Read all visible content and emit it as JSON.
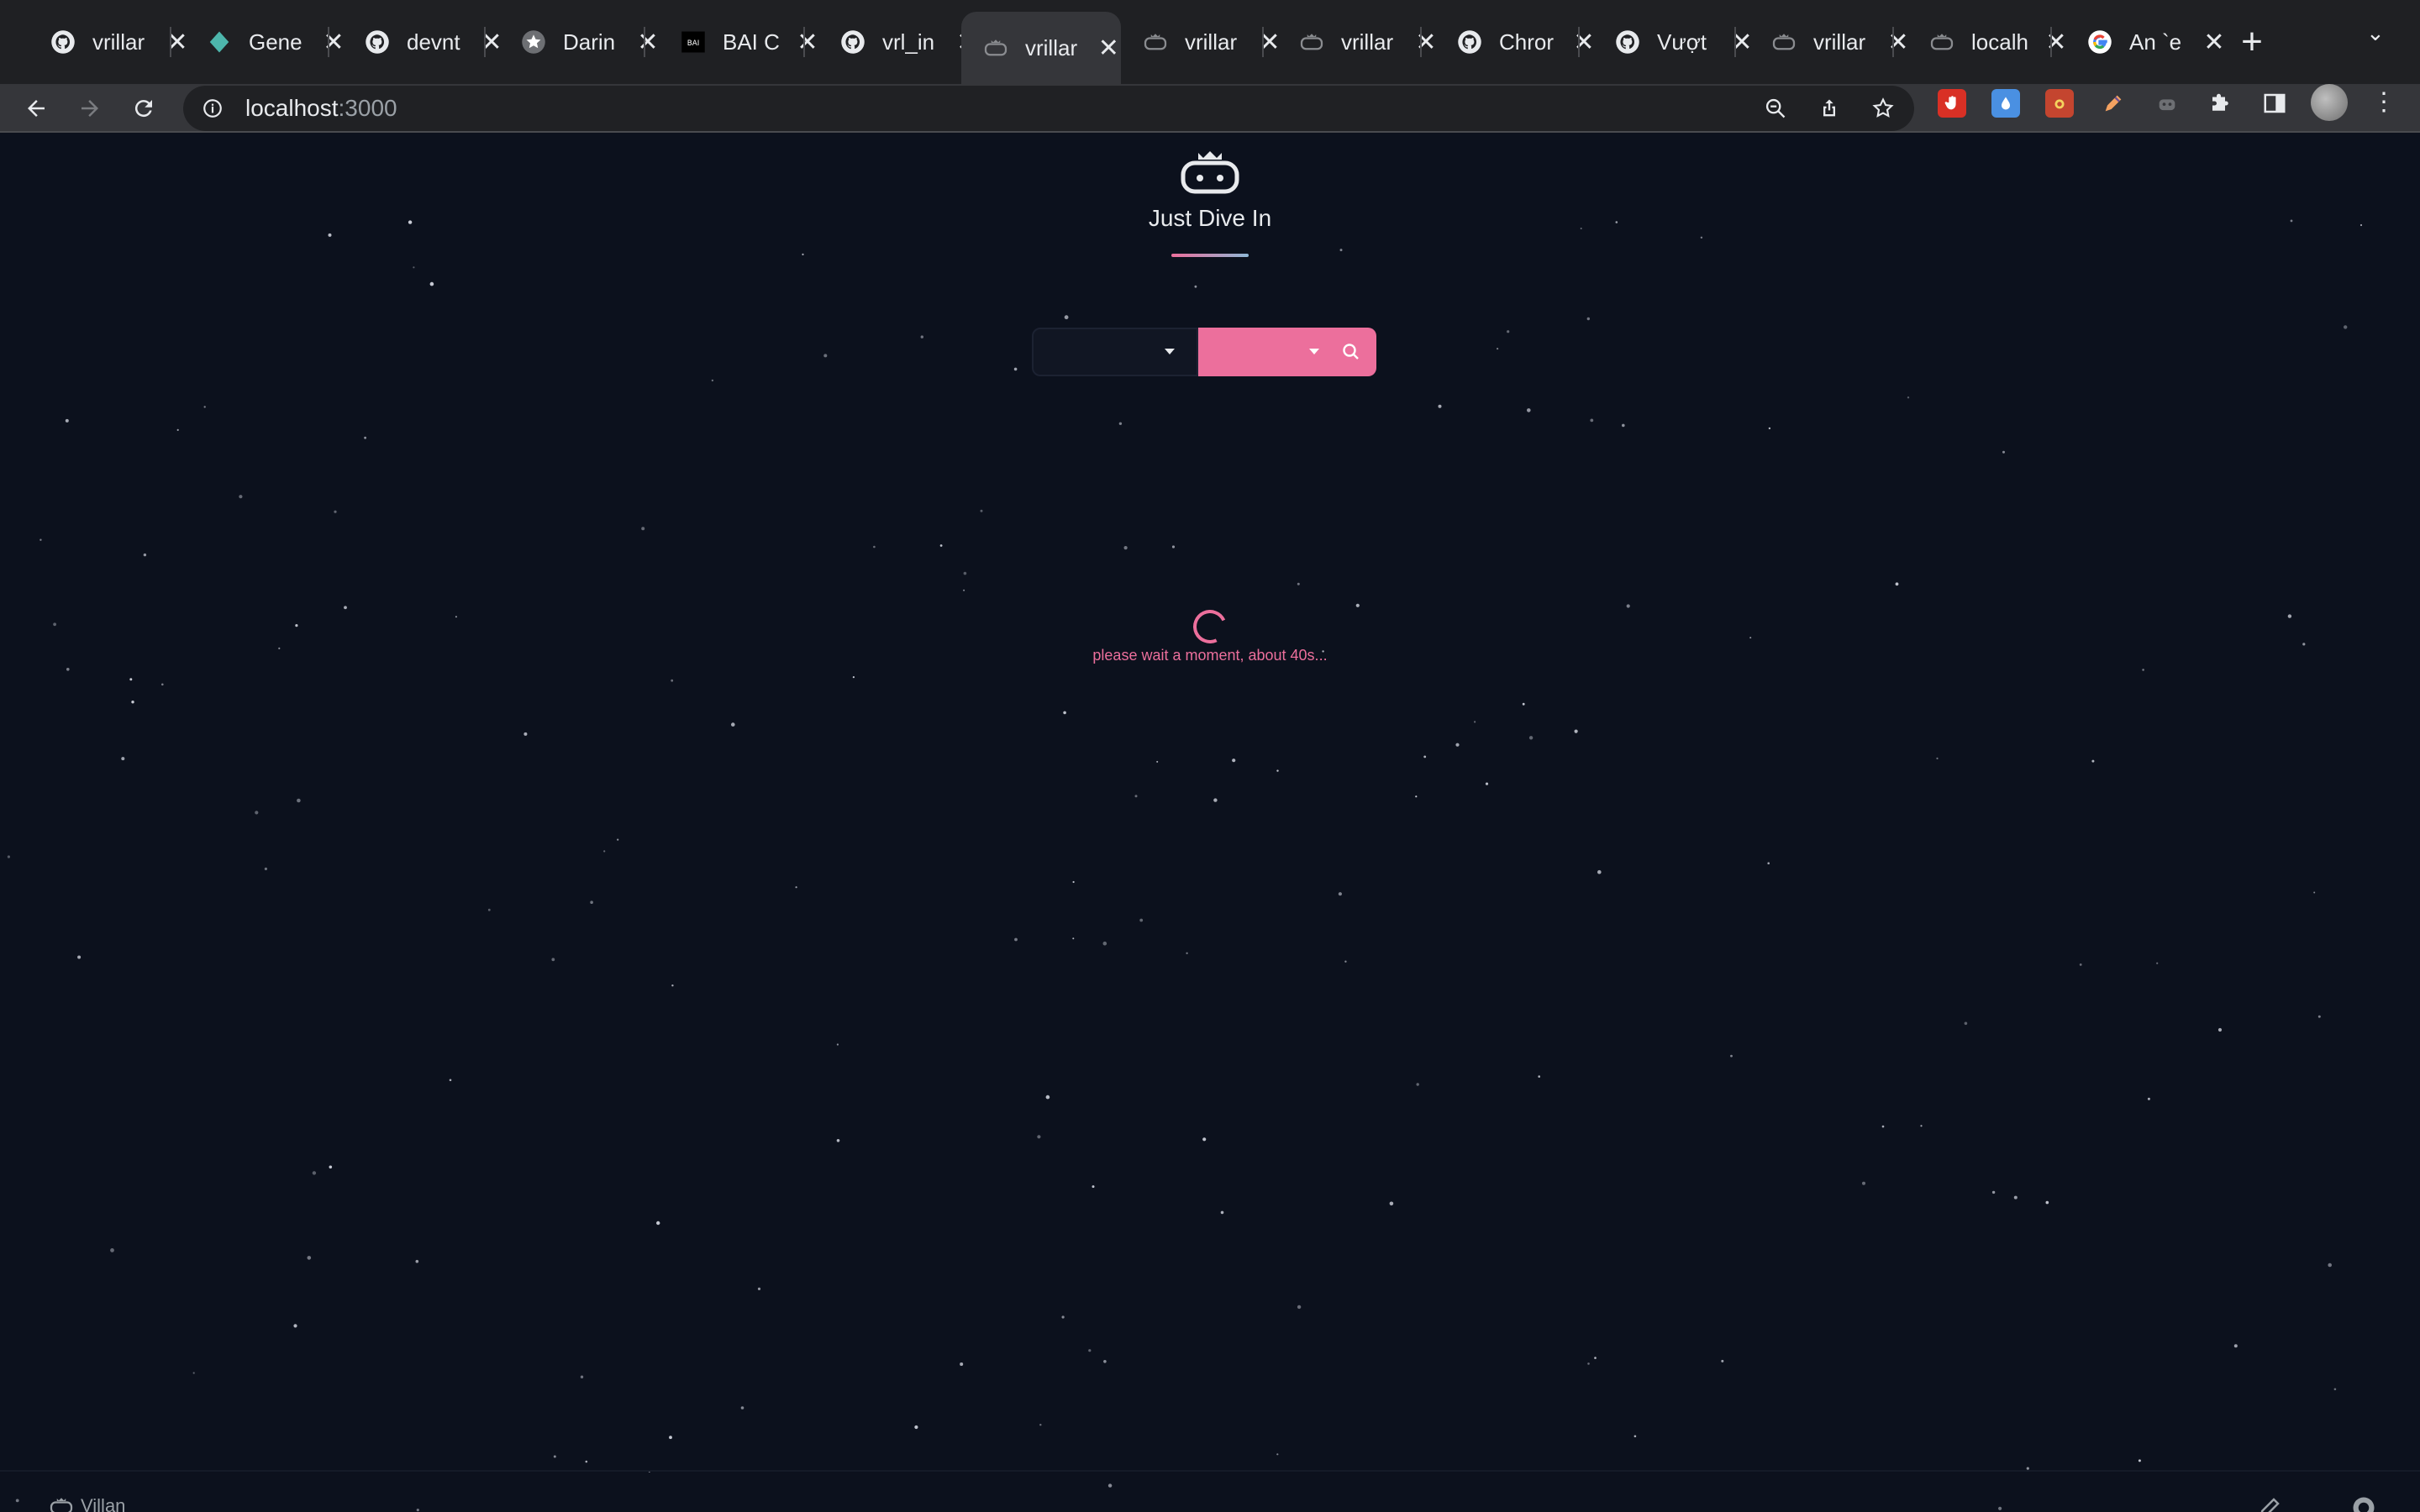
{
  "browser": {
    "tabs": [
      {
        "title": "vrillar",
        "icon": "github-icon"
      },
      {
        "title": "Gene",
        "icon": "gem-icon"
      },
      {
        "title": "devnt",
        "icon": "github-icon"
      },
      {
        "title": "Darin",
        "icon": "star-icon"
      },
      {
        "title": "BAI C",
        "icon": "bai-icon"
      },
      {
        "title": "vrl_in",
        "icon": "github-icon"
      },
      {
        "title": "vrillar",
        "icon": "robot-icon"
      },
      {
        "title": "vrillar",
        "icon": "robot-icon"
      },
      {
        "title": "vrillar",
        "icon": "robot-icon"
      },
      {
        "title": "Chror",
        "icon": "github-icon"
      },
      {
        "title": "Vượt",
        "icon": "github-icon"
      },
      {
        "title": "vrillar",
        "icon": "robot-icon"
      },
      {
        "title": "localh",
        "icon": "robot-icon"
      },
      {
        "title": "An `e",
        "icon": "google-icon"
      }
    ],
    "active_tab_index": 6,
    "close_glyph": "✕",
    "new_tab_glyph": "+",
    "address": {
      "host": "localhost",
      "port": ":3000"
    }
  },
  "page": {
    "brand_title": "Just Dive In",
    "select_left_value": "",
    "select_right_value": "",
    "loading_text": "please wait a moment, about 40s...",
    "footer_brand": "Villan"
  },
  "colors": {
    "background": "#0c111d",
    "accent": "#ec6f9c",
    "chrome_dark": "#1f2023",
    "chrome_toolbar": "#35363a"
  }
}
